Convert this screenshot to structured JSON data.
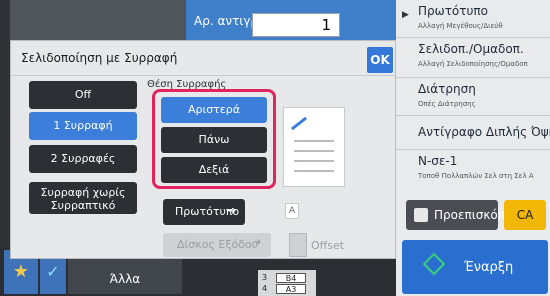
{
  "header": {
    "copies_label": "Αρ. αντιγράφων",
    "copies_value": "1"
  },
  "right_panel": {
    "items": [
      {
        "title": "Πρωτότυπο",
        "subtitle": "Αλλαγή Μεγέθους/Διεύθ"
      },
      {
        "title": "Σελιδοπ./Ομαδοπ.",
        "subtitle": "Αλλαγή Σελιδοποίησης/Ομαδοπ"
      },
      {
        "title": "Διάτρηση",
        "subtitle": "Οπές Διάτρησης"
      },
      {
        "title": "Αντίγραφο Διπλής Όψης",
        "subtitle": ""
      },
      {
        "title": "N-σε-1",
        "subtitle": "Τοποθ Πολλαπλών Σελ στη Σελ Α"
      }
    ],
    "preview_label": "Προεπισκόπ",
    "ca_label": "CA",
    "start_label": "Έναρξη"
  },
  "bottom_bar": {
    "other_label": "Άλλα",
    "paper": [
      {
        "num": "3",
        "size": "B4"
      },
      {
        "num": "4",
        "size": "A3"
      }
    ]
  },
  "dialog": {
    "title": "Σελιδοποίηση με Συρραφή",
    "ok_label": "OK",
    "staple_options": [
      {
        "label": "Off",
        "selected": false
      },
      {
        "label": "1 Συρραφή",
        "selected": true
      },
      {
        "label": "2 Συρραφές",
        "selected": false
      },
      {
        "label": "Συρραφή χωρίς Συρραπτικό",
        "selected": false
      }
    ],
    "position_section_label": "Θέση Συρραφής",
    "positions": [
      {
        "label": "Αριστερά",
        "selected": true
      },
      {
        "label": "Πάνω",
        "selected": false
      },
      {
        "label": "Δεξιά",
        "selected": false
      }
    ],
    "original_label": "Πρωτότυπο",
    "original_badge": "A",
    "output_tray_label": "Δίσκος Εξόδου",
    "offset_label": "Offset"
  },
  "colors": {
    "accent_blue": "#3b7fdb",
    "highlight_red": "#e0245e",
    "ca_yellow": "#f2b705",
    "start_blue": "#2a6fd0"
  }
}
